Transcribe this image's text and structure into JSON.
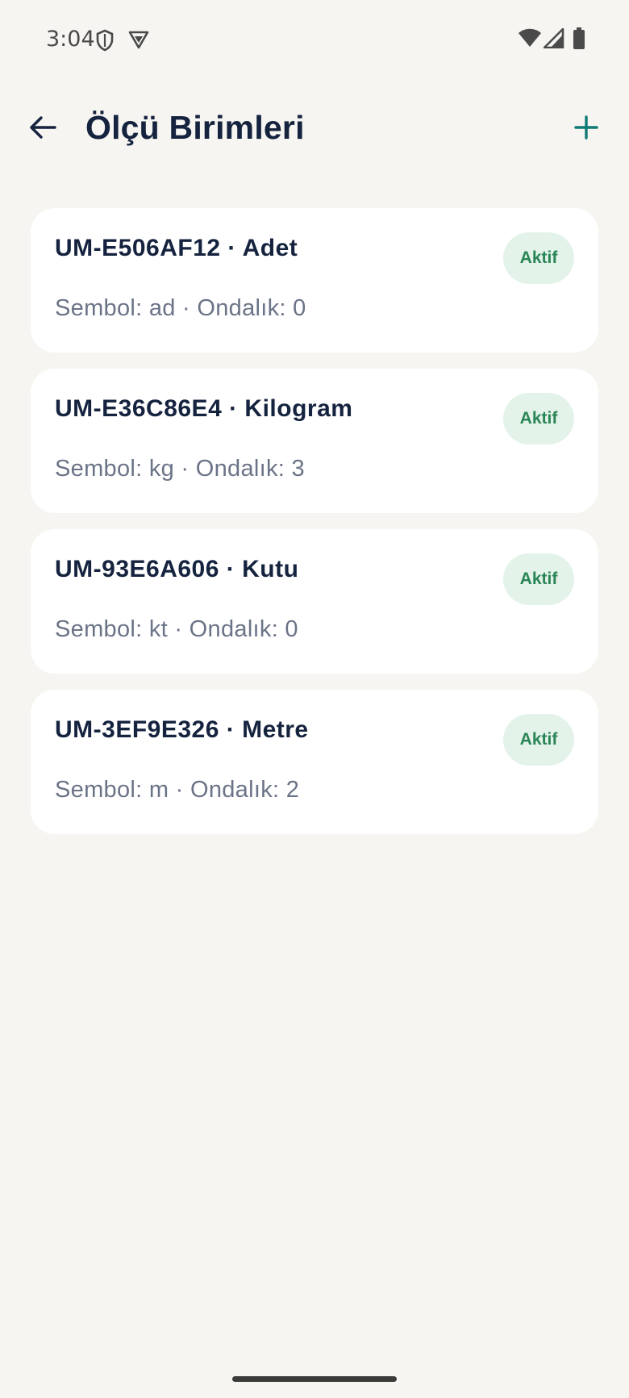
{
  "status_bar": {
    "time": "3:04",
    "icons": [
      "shield-icon",
      "vpn-icon",
      "wifi-icon",
      "signal-icon",
      "battery-icon"
    ]
  },
  "app_bar": {
    "title": "Ölçü Birimleri",
    "back_icon": "arrow-left-icon",
    "add_icon": "plus-icon"
  },
  "colors": {
    "background": "#f6f5f1",
    "card": "#ffffff",
    "title_text": "#15233f",
    "subtitle_text": "#6b7387",
    "accent": "#0f7a76",
    "badge_bg": "#e3f3ea",
    "badge_text": "#2a8556"
  },
  "units": [
    {
      "title": "UM-E506AF12 · Adet",
      "subtitle": "Sembol: ad · Ondalık: 0",
      "status": "Aktif"
    },
    {
      "title": "UM-E36C86E4 · Kilogram",
      "subtitle": "Sembol: kg · Ondalık: 3",
      "status": "Aktif"
    },
    {
      "title": "UM-93E6A606 · Kutu",
      "subtitle": "Sembol: kt · Ondalık: 0",
      "status": "Aktif"
    },
    {
      "title": "UM-3EF9E326 · Metre",
      "subtitle": "Sembol: m · Ondalık: 2",
      "status": "Aktif"
    }
  ]
}
